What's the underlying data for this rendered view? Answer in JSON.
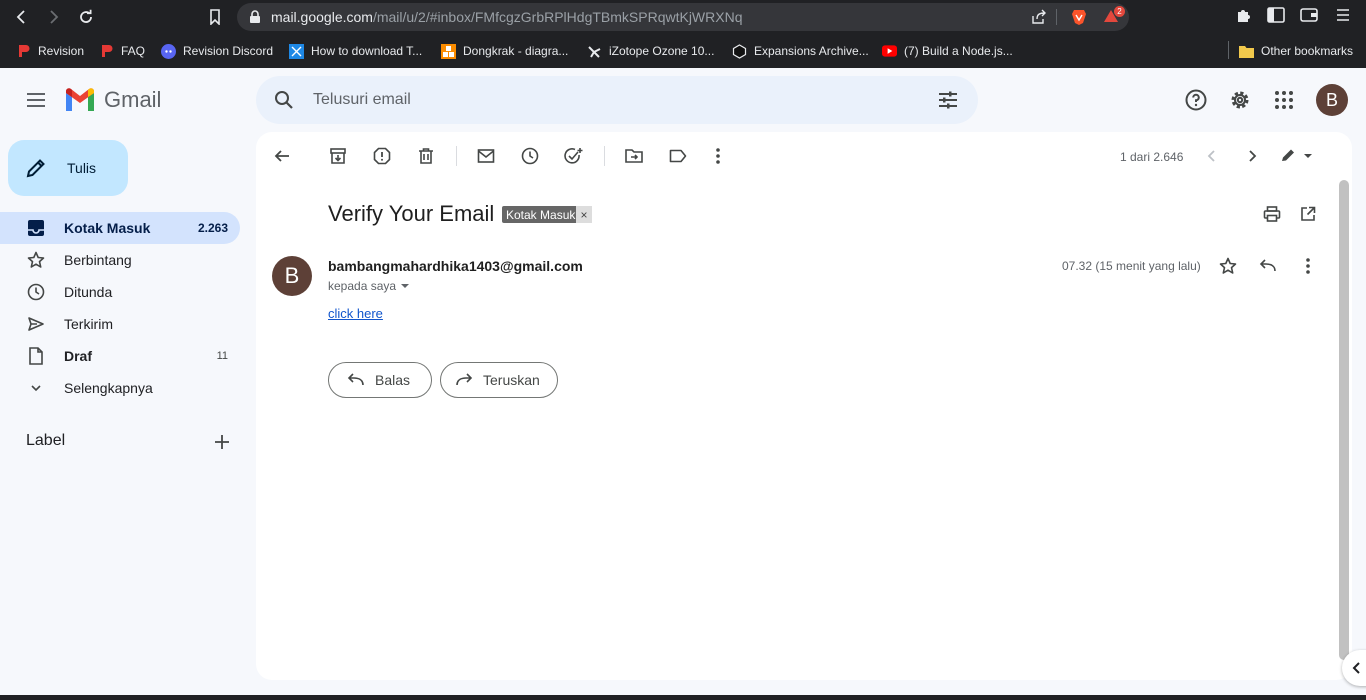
{
  "browser": {
    "url_host": "mail.google.com",
    "url_path": "/mail/u/2/#inbox/FMfcgzGrbRPlHdgTBmkSPRqwtKjWRXNq",
    "rewards_badge": "2"
  },
  "bookmarks": [
    {
      "label": "Revision",
      "icon": "revision-icon",
      "color": "#e53935"
    },
    {
      "label": "FAQ",
      "icon": "revision-icon",
      "color": "#e53935"
    },
    {
      "label": "Revision Discord",
      "icon": "discord-icon",
      "color": "#5865f2"
    },
    {
      "label": "How to download T...",
      "icon": "blue-square-icon",
      "color": "#1e88e5"
    },
    {
      "label": "Dongkrak - diagra...",
      "icon": "orange-grid-icon",
      "color": "#fb8c00"
    },
    {
      "label": "iZotope Ozone 10...",
      "icon": "izotope-icon",
      "color": "#000000"
    },
    {
      "label": "Expansions Archive...",
      "icon": "hex-icon",
      "color": "#000000"
    },
    {
      "label": "(7) Build a Node.js...",
      "icon": "youtube-icon",
      "color": "#ff0000"
    }
  ],
  "other_bookmarks": "Other bookmarks",
  "gmail": {
    "brand": "Gmail",
    "search_placeholder": "Telusuri email",
    "avatar_letter": "B",
    "compose_label": "Tulis"
  },
  "nav": [
    {
      "label": "Kotak Masuk",
      "count": "2.263",
      "icon": "inbox-icon",
      "active": true
    },
    {
      "label": "Berbintang",
      "count": "",
      "icon": "star-icon"
    },
    {
      "label": "Ditunda",
      "count": "",
      "icon": "clock-icon"
    },
    {
      "label": "Terkirim",
      "count": "",
      "icon": "send-icon"
    },
    {
      "label": "Draf",
      "count": "11",
      "icon": "draft-icon",
      "bold": true
    },
    {
      "label": "Selengkapnya",
      "count": "",
      "icon": "chevron-down-icon"
    }
  ],
  "labels_heading": "Label",
  "toolbar": {
    "pager": "1 dari 2.646"
  },
  "message": {
    "subject": "Verify Your Email",
    "chip": "Kotak Masuk",
    "chip_close": "×",
    "sender_letter": "B",
    "sender": "bambangmahardhika1403@gmail.com",
    "to": "kepada saya",
    "time": "07.32 (15 menit yang lalu)",
    "body_link": "click here",
    "reply_label": "Balas",
    "forward_label": "Teruskan"
  }
}
